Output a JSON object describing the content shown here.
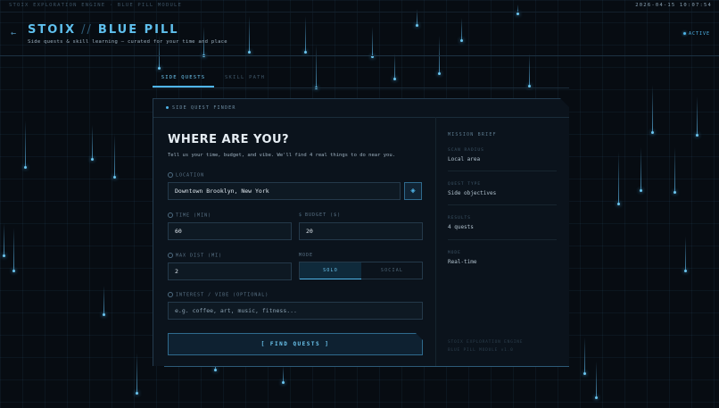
{
  "topbar": {
    "left": "STOIX EXPLORATION ENGINE · BLUE PILL MODULE",
    "right": "2026-04-15 10:07:54"
  },
  "header": {
    "back_icon": "arrow-left-icon",
    "title_a": "STOIX",
    "title_sep": "//",
    "title_b": "BLUE PILL",
    "subtitle": "Side quests & skill learning — curated for your time and place",
    "status": "ACTIVE"
  },
  "tabs": [
    {
      "label": "SIDE QUESTS",
      "active": true
    },
    {
      "label": "SKILL PATH",
      "active": false
    }
  ],
  "panel": {
    "header_label": "SIDE QUEST FINDER",
    "heading": "WHERE ARE YOU?",
    "description": "Tell us your time, budget, and vibe. We'll find 4 real things to do near you.",
    "location": {
      "label": "LOCATION",
      "value": "Downtown Brooklyn, New York",
      "button_icon": "diamond-locate-icon"
    },
    "time": {
      "label": "TIME (MIN)",
      "value": "60"
    },
    "budget": {
      "label": "BUDGET ($)",
      "value": "20"
    },
    "max_dist": {
      "label": "MAX DIST (MI)",
      "value": "2"
    },
    "mode": {
      "label": "MODE",
      "options": [
        "SOLO",
        "SOCIAL"
      ],
      "selected": "SOLO"
    },
    "interest": {
      "label": "INTEREST / VIBE (OPTIONAL)",
      "placeholder": "e.g. coffee, art, music, fitness..."
    },
    "cta": "[ FIND QUESTS ]"
  },
  "brief": {
    "title": "MISSION BRIEF",
    "items": [
      {
        "key": "SCAN RADIUS",
        "value": "Local area"
      },
      {
        "key": "QUEST TYPE",
        "value": "Side objectives"
      },
      {
        "key": "RESULTS",
        "value": "4 quests"
      },
      {
        "key": "MODE",
        "value": "Real-time"
      }
    ],
    "footer_1": "STOIX EXPLORATION ENGINE",
    "footer_2": "BLUE PILL MODULE v1.0"
  },
  "colors": {
    "accent": "#4fb4e8",
    "background": "#070c12",
    "panel": "#0b131c"
  }
}
